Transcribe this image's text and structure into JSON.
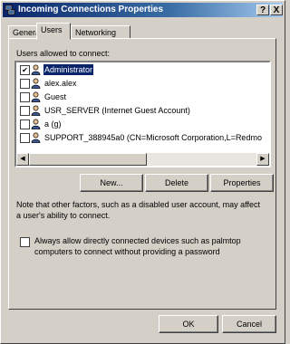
{
  "window": {
    "title": "Incoming Connections Properties",
    "help_button": "?",
    "close_button": "X"
  },
  "tabs": [
    {
      "label": "General",
      "active": false
    },
    {
      "label": "Users",
      "active": true
    },
    {
      "label": "Networking",
      "active": false
    }
  ],
  "users": {
    "label": "Users allowed to connect:",
    "items": [
      {
        "name": "Administrator",
        "checked": true,
        "selected": true
      },
      {
        "name": "alex.alex",
        "checked": false,
        "selected": false
      },
      {
        "name": "Guest",
        "checked": false,
        "selected": false
      },
      {
        "name": "USR_SERVER (Internet Guest Account)",
        "checked": false,
        "selected": false
      },
      {
        "name": "a (g)",
        "checked": false,
        "selected": false
      },
      {
        "name": "SUPPORT_388945a0 (CN=Microsoft Corporation,L=Redmo",
        "checked": false,
        "selected": false
      }
    ],
    "scroll_left": "◀",
    "scroll_right": "▶"
  },
  "buttons": {
    "new": "New...",
    "delete": "Delete",
    "properties": "Properties",
    "ok": "OK",
    "cancel": "Cancel"
  },
  "note": "Note that other factors, such as a disabled user account, may affect a user's ability to connect.",
  "direct_devices": {
    "label": "Always allow directly connected devices such as palmtop computers to connect without providing a password",
    "checked": false
  },
  "checkmark": "✔",
  "colors": {
    "titlebar": "#0a246a",
    "selection": "#0a246a",
    "face": "#d4d0c8"
  }
}
